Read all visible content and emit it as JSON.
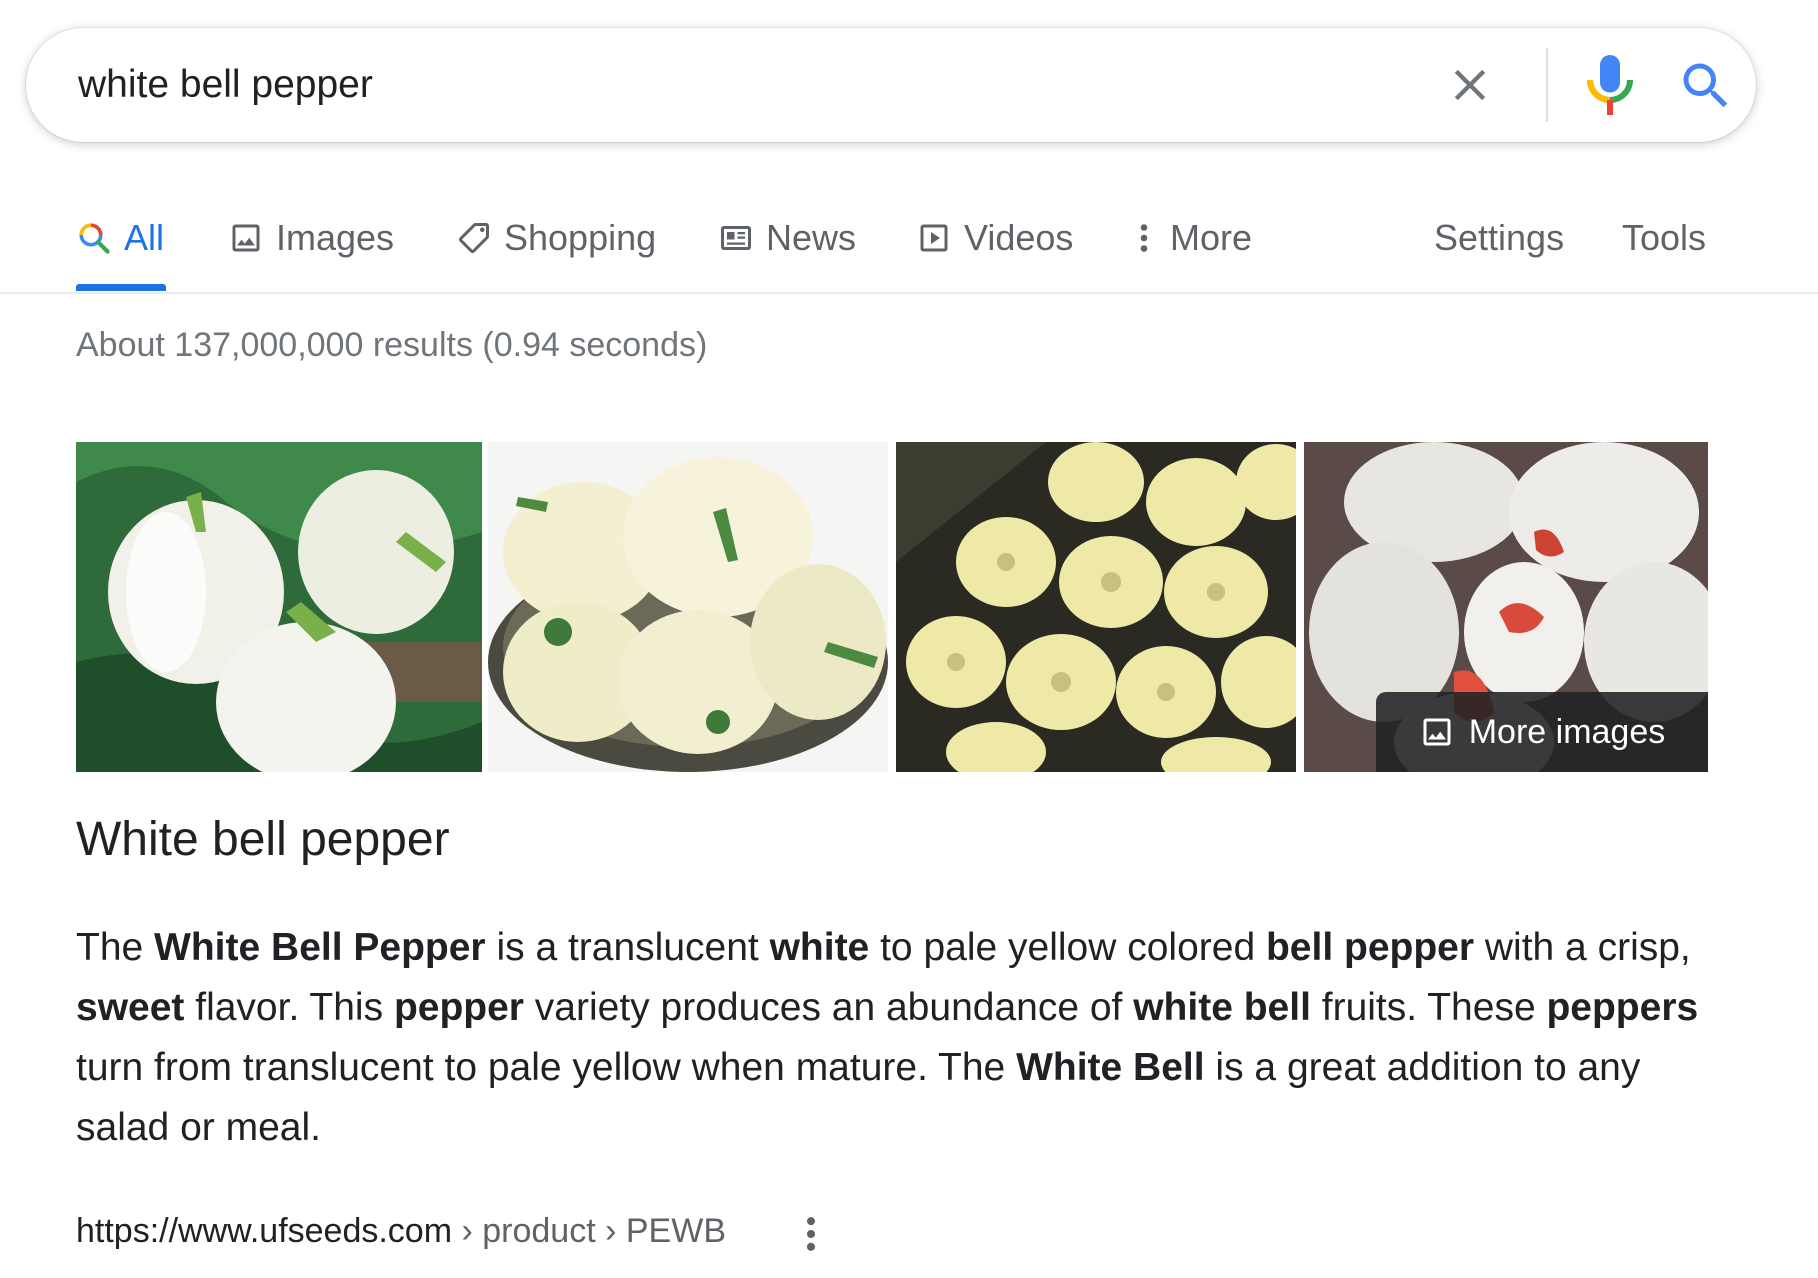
{
  "search": {
    "query": "white bell pepper"
  },
  "tabs": [
    {
      "label": "All",
      "icon": "search-icon",
      "active": true
    },
    {
      "label": "Images",
      "icon": "image-icon"
    },
    {
      "label": "Shopping",
      "icon": "tag-icon"
    },
    {
      "label": "News",
      "icon": "newspaper-icon"
    },
    {
      "label": "Videos",
      "icon": "play-icon"
    },
    {
      "label": "More",
      "icon": "more-vert-icon"
    }
  ],
  "tools": {
    "settings_label": "Settings",
    "tools_label": "Tools"
  },
  "result_stats": "About 137,000,000 results (0.94 seconds)",
  "images": {
    "more_label": "More images"
  },
  "knowledge_panel": {
    "title": "White bell pepper",
    "snippet": [
      {
        "t": "The ",
        "b": false
      },
      {
        "t": "White Bell Pepper",
        "b": true
      },
      {
        "t": " is a translucent ",
        "b": false
      },
      {
        "t": "white",
        "b": true
      },
      {
        "t": " to pale yellow colored ",
        "b": false
      },
      {
        "t": "bell pepper",
        "b": true
      },
      {
        "t": " with a crisp, ",
        "b": false
      },
      {
        "t": "sweet",
        "b": true
      },
      {
        "t": " flavor. This ",
        "b": false
      },
      {
        "t": "pepper",
        "b": true
      },
      {
        "t": " variety produces an abundance of ",
        "b": false
      },
      {
        "t": "white bell",
        "b": true
      },
      {
        "t": " fruits. These ",
        "b": false
      },
      {
        "t": "peppers",
        "b": true
      },
      {
        "t": " turn from translucent to pale yellow when mature. The ",
        "b": false
      },
      {
        "t": "White Bell",
        "b": true
      },
      {
        "t": " is a great addition to any salad or meal.",
        "b": false
      }
    ],
    "source_url": "https://www.ufseeds.com",
    "source_path": " › product › PEWB"
  },
  "colors": {
    "accent": "#1a73e8",
    "text": "#202124",
    "muted": "#5f6368"
  }
}
